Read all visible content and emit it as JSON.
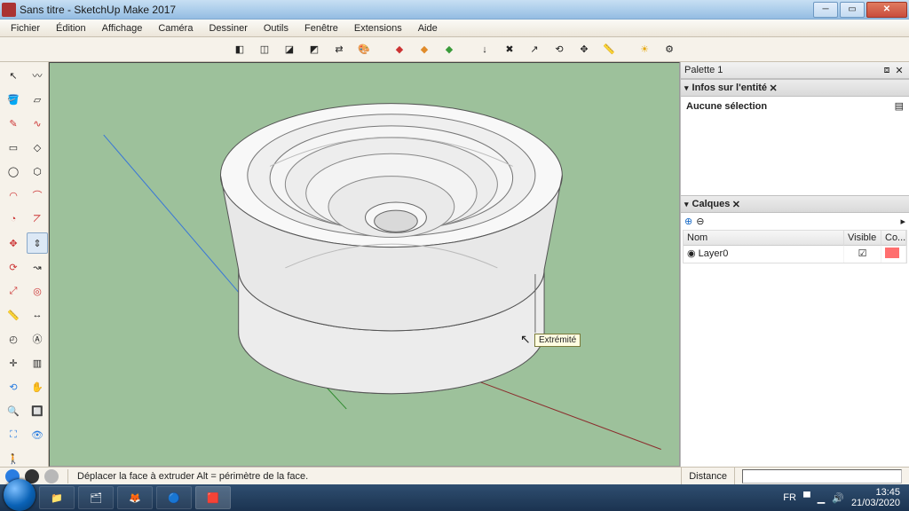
{
  "title": "Sans titre - SketchUp Make 2017",
  "menu": [
    "Fichier",
    "Édition",
    "Affichage",
    "Caméra",
    "Dessiner",
    "Outils",
    "Fenêtre",
    "Extensions",
    "Aide"
  ],
  "top_toolbar_icons": [
    "cube-solid",
    "cube-wire",
    "cube-hidden",
    "cube-color",
    "swap-icon",
    "palette-icon",
    "|",
    "push-red",
    "push-orange",
    "push-green",
    "|",
    "arrow-down-red",
    "cross-red",
    "arrow-diag",
    "orbit-small",
    "pan-small",
    "tape-small",
    "|",
    "sun-icon",
    "gear-icon"
  ],
  "left_tools": [
    [
      "select-arrow",
      "lasso-icon"
    ],
    [
      "paint-bucket",
      "eraser-icon"
    ],
    [
      "pencil-icon",
      "freehand-icon"
    ],
    [
      "rectangle-icon",
      "rect-rotated-icon"
    ],
    [
      "circle-icon",
      "polygon-icon"
    ],
    [
      "arc-2pt-icon",
      "arc-icon"
    ],
    [
      "pie-icon",
      "arc3-icon"
    ],
    [
      "move-icon",
      "pushpull-icon"
    ],
    [
      "rotate-icon",
      "followme-icon"
    ],
    [
      "scale-icon",
      "offset-icon"
    ],
    [
      "tape-icon",
      "dimension-icon"
    ],
    [
      "protractor-icon",
      "text-label-icon"
    ],
    [
      "axes-icon",
      "section-icon"
    ],
    [
      "orbit-icon",
      "pan-icon"
    ],
    [
      "zoom-icon",
      "zoom-window-icon"
    ],
    [
      "zoom-extents-icon",
      "look-around-icon"
    ],
    [
      "walk-icon",
      ""
    ]
  ],
  "left_selected": "pushpull-icon",
  "tooltip": "Extrémité",
  "right": {
    "dock_title": "Palette 1",
    "entity": {
      "title": "Infos sur l'entité",
      "body": "Aucune sélection"
    },
    "layers": {
      "title": "Calques",
      "cols": [
        "Nom",
        "Visible",
        "Co..."
      ],
      "rows": [
        {
          "name": "Layer0",
          "visible": true,
          "color": "#ff6f6f"
        }
      ]
    }
  },
  "status": {
    "hint": "Déplacer la face à extruder  Alt = périmètre de la face.",
    "measure_label": "Distance"
  },
  "taskbar": {
    "lang": "FR",
    "time": "13:45",
    "date": "21/03/2020"
  }
}
